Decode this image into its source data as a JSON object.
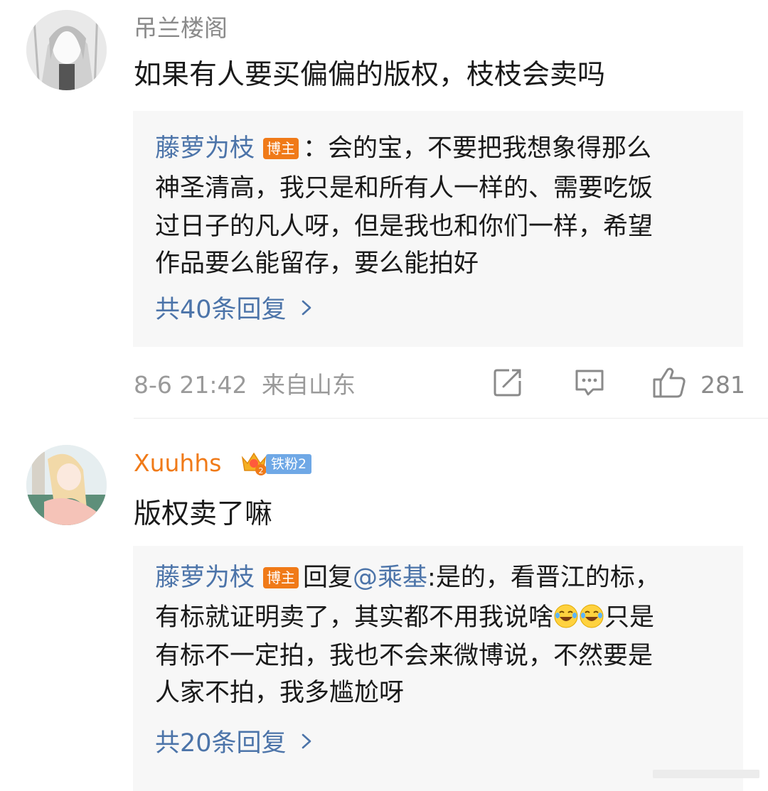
{
  "comments": [
    {
      "username": "吊兰楼阁",
      "content": "如果有人要买偏偏的版权，枝枝会卖吗",
      "reply": {
        "author": "藤萝为枝",
        "badge": "博主",
        "lines": [
          "：会的宝，不要把我想象得那么",
          "神圣清高，我只是和所有人一样的、需要吃饭",
          "过日子的凡人呀，但是我也和你们一样，希望",
          "作品要么能留存，要么能拍好"
        ]
      },
      "more_replies": "共40条回复",
      "timestamp": "8-6 21:42",
      "location": "来自山东",
      "likes": "281",
      "icons": [
        "share-icon",
        "comment-icon",
        "like-icon"
      ]
    },
    {
      "username": "Xuuhhs",
      "fan_badge": "铁粉2",
      "content": "版权卖了嘛",
      "reply": {
        "author": "藤萝为枝",
        "badge": "博主",
        "prefix": "回复",
        "mention": "@乘基",
        "lines": [
          ":是的，看晋江的标，",
          "有标就证明卖了，其实都不用我说啥",
          "只是",
          "有标不一定拍，我也不会来微博说，不然要是",
          "人家不拍，我多尴尬呀"
        ]
      },
      "more_replies": "共20条回复"
    }
  ],
  "colors": {
    "link_blue": "#4c74a9",
    "orange": "#f07a18",
    "fan_badge_blue": "#6fa8e6",
    "reply_bg": "#f7f7f7"
  }
}
